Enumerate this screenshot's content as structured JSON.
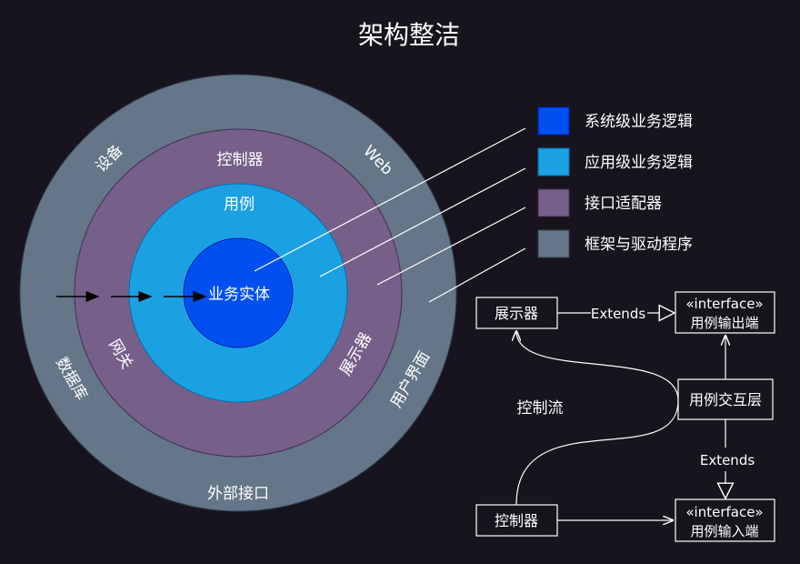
{
  "title": "架构整洁",
  "rings": {
    "outer": {
      "label": "外部接口",
      "color": "#647687"
    },
    "adapter": {
      "label": "控制器",
      "color": "#76608a"
    },
    "usecase": {
      "label": "用例",
      "color": "#1ba1e2"
    },
    "core": {
      "label": "业务实体",
      "color": "#0050ef"
    }
  },
  "outer_labels": {
    "device": "设备",
    "web": "Web",
    "database": "数据库",
    "ui": "用户界面"
  },
  "adapter_labels": {
    "gateway": "网关",
    "presenter": "展示器"
  },
  "legend": [
    {
      "label": "系统级业务逻辑",
      "color": "#0050ef"
    },
    {
      "label": "应用级业务逻辑",
      "color": "#1ba1e2"
    },
    {
      "label": "接口适配器",
      "color": "#76608a"
    },
    {
      "label": "框架与驱动程序",
      "color": "#647687"
    }
  ],
  "flow": {
    "presenter": "展示器",
    "output_port": {
      "stereo": "«interface»",
      "name": "用例输出端"
    },
    "interactor": "用例交互层",
    "input_port": {
      "stereo": "«interface»",
      "name": "用例输入端"
    },
    "controller": "控制器",
    "extends_top": "Extends",
    "extends_mid": "Extends",
    "control_flow": "控制流"
  },
  "colors": {
    "background": "#18141d",
    "line": "#ffffff",
    "box_border": "#ffffff"
  }
}
